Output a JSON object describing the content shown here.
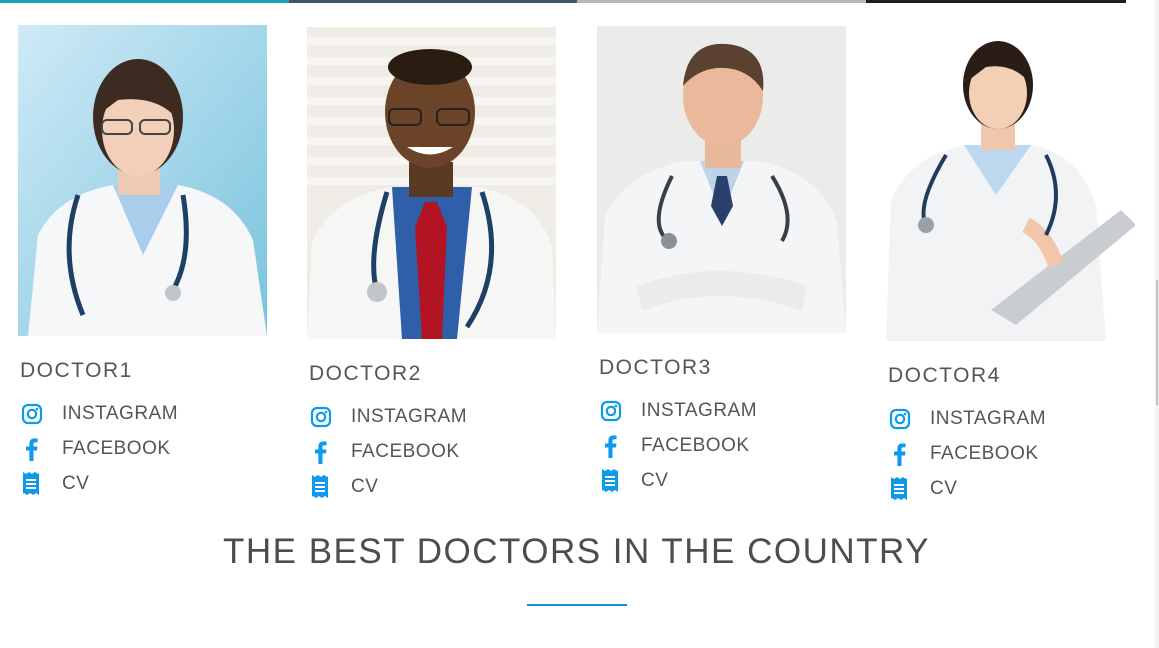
{
  "accent_color": "#0d9aea",
  "doctors": [
    {
      "name": "DOCTOR1",
      "links": [
        {
          "icon": "instagram-icon",
          "label": "INSTAGRAM"
        },
        {
          "icon": "facebook-icon",
          "label": "FACEBOOK"
        },
        {
          "icon": "cv-document-icon",
          "label": "CV"
        }
      ]
    },
    {
      "name": "DOCTOR2",
      "links": [
        {
          "icon": "instagram-icon",
          "label": "INSTAGRAM"
        },
        {
          "icon": "facebook-icon",
          "label": "FACEBOOK"
        },
        {
          "icon": "cv-document-icon",
          "label": "CV"
        }
      ]
    },
    {
      "name": "DOCTOR3",
      "links": [
        {
          "icon": "instagram-icon",
          "label": "INSTAGRAM"
        },
        {
          "icon": "facebook-icon",
          "label": "FACEBOOK"
        },
        {
          "icon": "cv-document-icon",
          "label": "CV"
        }
      ]
    },
    {
      "name": "DOCTOR4",
      "links": [
        {
          "icon": "instagram-icon",
          "label": "INSTAGRAM"
        },
        {
          "icon": "facebook-icon",
          "label": "FACEBOOK"
        },
        {
          "icon": "cv-document-icon",
          "label": "CV"
        }
      ]
    }
  ],
  "section": {
    "headline": "THE BEST DOCTORS IN THE COUNTRY"
  }
}
